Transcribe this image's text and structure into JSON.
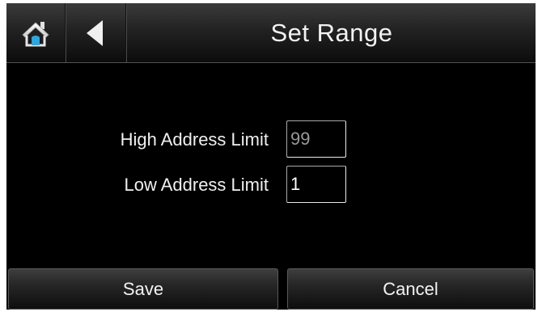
{
  "header": {
    "title": "Set Range",
    "home_icon": "home-icon",
    "back_icon": "back-arrow-icon"
  },
  "form": {
    "high": {
      "label": "High Address Limit",
      "value": "99"
    },
    "low": {
      "label": "Low Address Limit",
      "value": "1"
    }
  },
  "buttons": {
    "save": "Save",
    "cancel": "Cancel"
  },
  "colors": {
    "home_accent": "#29a8e0",
    "background": "#000000"
  }
}
